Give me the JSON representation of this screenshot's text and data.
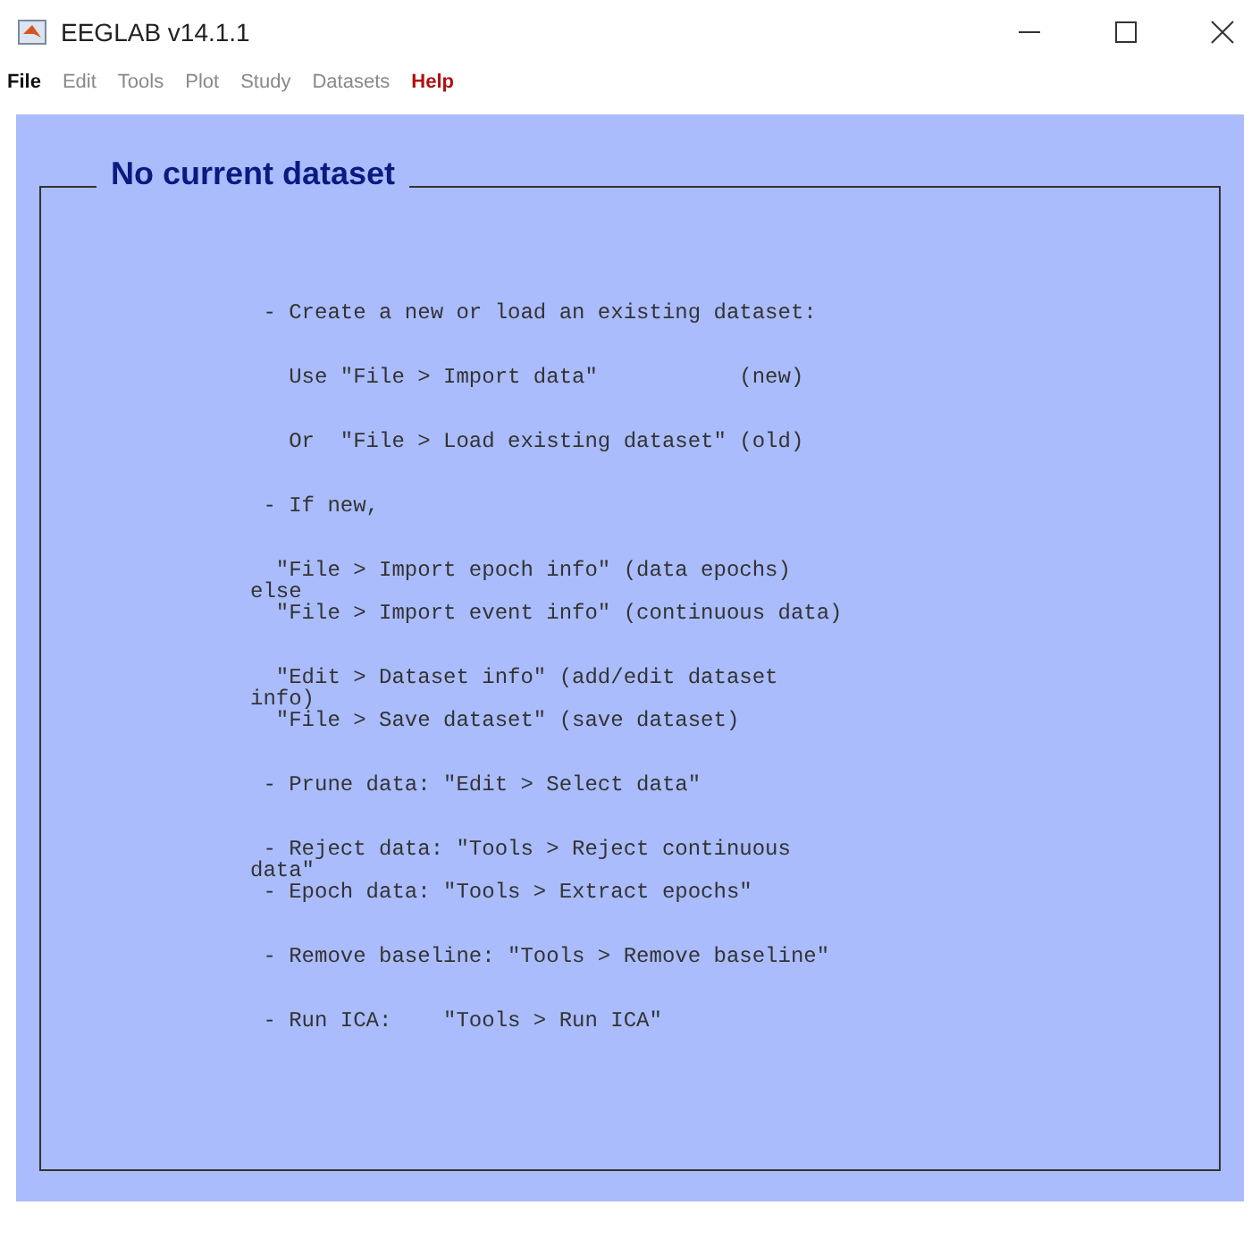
{
  "window": {
    "title": "EEGLAB v14.1.1"
  },
  "menu": [
    {
      "label": "File",
      "kind": "normal"
    },
    {
      "label": "Edit",
      "kind": "dim"
    },
    {
      "label": "Tools",
      "kind": "dim"
    },
    {
      "label": "Plot",
      "kind": "dim"
    },
    {
      "label": "Study",
      "kind": "dim"
    },
    {
      "label": "Datasets",
      "kind": "dim"
    },
    {
      "label": "Help",
      "kind": "help"
    }
  ],
  "panel": {
    "title": "No current dataset",
    "paragraphs": [
      [
        " - Create a new or load an existing dataset:"
      ],
      [
        "   Use \"File > Import data\"           (new)"
      ],
      [
        "   Or  \"File > Load existing dataset\" (old)"
      ],
      [
        " - If new,"
      ],
      [
        "  \"File > Import epoch info\" (data epochs)",
        "else",
        "  \"File > Import event info\" (continuous data)"
      ],
      [
        "  \"Edit > Dataset info\" (add/edit dataset",
        "info)",
        "  \"File > Save dataset\" (save dataset)"
      ],
      [
        " - Prune data: \"Edit > Select data\""
      ],
      [
        " - Reject data: \"Tools > Reject continuous",
        "data\"",
        " - Epoch data: \"Tools > Extract epochs\""
      ],
      [
        " - Remove baseline: \"Tools > Remove baseline\""
      ],
      [
        " - Run ICA:    \"Tools > Run ICA\""
      ]
    ]
  }
}
